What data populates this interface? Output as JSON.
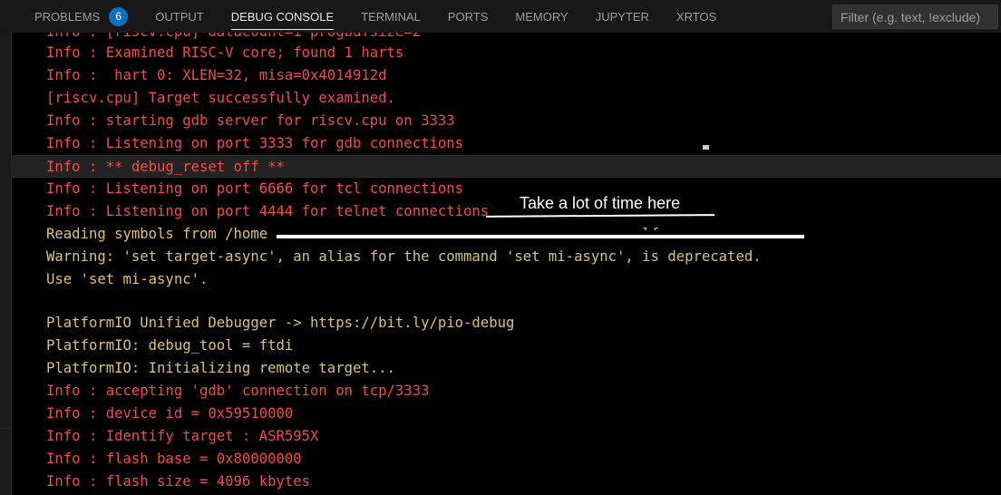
{
  "tabs": [
    {
      "label": "PROBLEMS",
      "badge": "6",
      "active": false
    },
    {
      "label": "OUTPUT",
      "active": false
    },
    {
      "label": "DEBUG CONSOLE",
      "active": true
    },
    {
      "label": "TERMINAL",
      "active": false
    },
    {
      "label": "PORTS",
      "active": false
    },
    {
      "label": "MEMORY",
      "active": false
    },
    {
      "label": "JUPYTER",
      "active": false
    },
    {
      "label": "XRTOS",
      "active": false
    }
  ],
  "filter": {
    "placeholder": "Filter (e.g. text, !exclude)",
    "value": ""
  },
  "annotation": "Take a lot of time here",
  "colors": {
    "error": "#f14c4c",
    "warning": "#dcc178",
    "badge": "#0e70c0"
  },
  "lines": [
    {
      "text": "Info : [riscv.cpu] datacount=1 progbufsize=2",
      "color": "red"
    },
    {
      "text": "Info : Examined RISC-V core; found 1 harts",
      "color": "red"
    },
    {
      "text": "Info :  hart 0: XLEN=32, misa=0x4014912d",
      "color": "red"
    },
    {
      "text": "[riscv.cpu] Target successfully examined.",
      "color": "red"
    },
    {
      "text": "Info : starting gdb server for riscv.cpu on 3333",
      "color": "red"
    },
    {
      "text": "Info : Listening on port 3333 for gdb connections",
      "color": "red"
    },
    {
      "text": "Info : ** debug_reset off **",
      "color": "red",
      "highlight": true
    },
    {
      "text": "Info : Listening on port 6666 for tcl connections",
      "color": "red"
    },
    {
      "text": "Info : Listening on port 4444 for telnet connections",
      "color": "red"
    },
    {
      "text": "Reading symbols from /home                                          .elf...",
      "color": "yellow"
    },
    {
      "text": "Warning: 'set target-async', an alias for the command 'set mi-async', is deprecated.",
      "color": "yellow"
    },
    {
      "text": "Use 'set mi-async'.",
      "color": "yellow"
    },
    {
      "text": "",
      "color": "yellow"
    },
    {
      "text": "PlatformIO Unified Debugger -> https://bit.ly/pio-debug",
      "color": "yellow"
    },
    {
      "text": "PlatformIO: debug_tool = ftdi",
      "color": "yellow"
    },
    {
      "text": "PlatformIO: Initializing remote target...",
      "color": "yellow"
    },
    {
      "text": "Info : accepting 'gdb' connection on tcp/3333",
      "color": "red"
    },
    {
      "text": "Info : device id = 0x59510000",
      "color": "red"
    },
    {
      "text": "Info : Identify target : ASR595X",
      "color": "red"
    },
    {
      "text": "Info : flash base = 0x80000000",
      "color": "red"
    },
    {
      "text": "Info : flash size = 4096 kbytes",
      "color": "red"
    }
  ]
}
